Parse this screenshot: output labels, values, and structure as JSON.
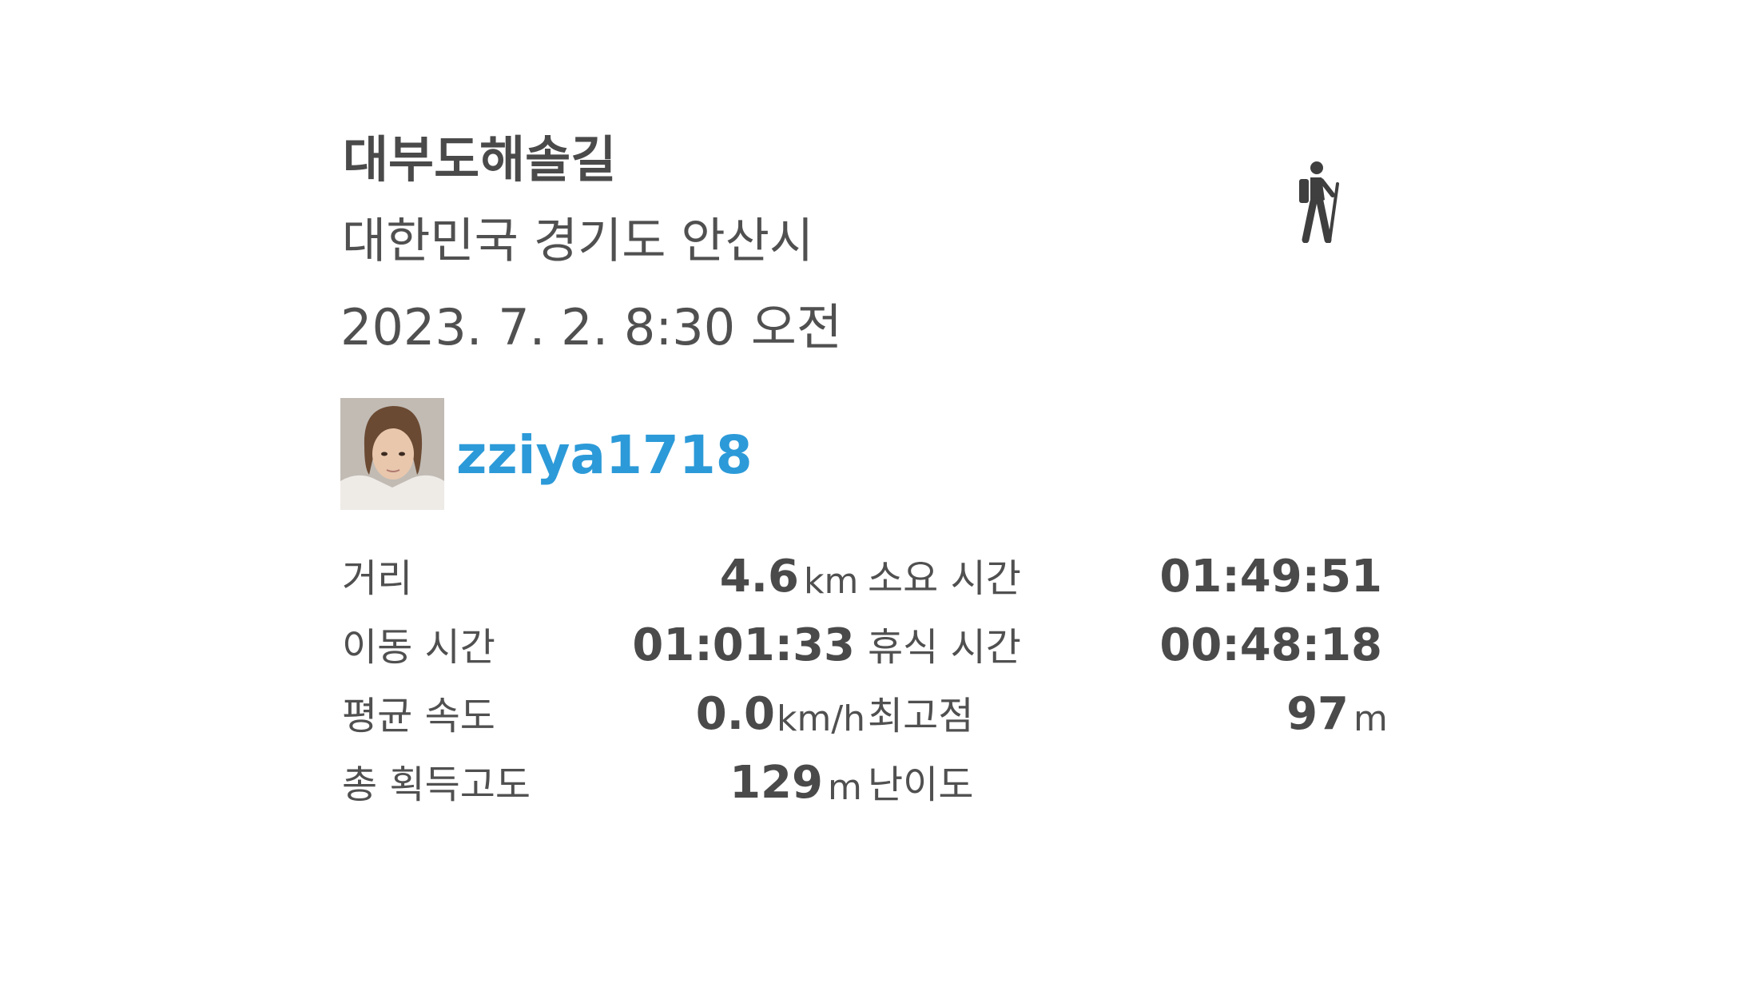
{
  "track": {
    "title": "대부도해솔길",
    "location": "대한민국 경기도 안산시",
    "datetime": "2023. 7. 2. 8:30 오전",
    "activity_icon": "hiking-icon"
  },
  "user": {
    "username": "zziya1718",
    "avatar": "profile-photo"
  },
  "stats": {
    "distance": {
      "label": "거리",
      "value": "4.6",
      "unit": "km"
    },
    "total_time": {
      "label": "소요 시간",
      "value": "01:49:51"
    },
    "moving_time": {
      "label": "이동 시간",
      "value": "01:01:33"
    },
    "rest_time": {
      "label": "휴식 시간",
      "value": "00:48:18"
    },
    "avg_speed": {
      "label": "평균 속도",
      "value": "0.0",
      "unit": "km/h"
    },
    "max_elevation": {
      "label": "최고점",
      "value": "97",
      "unit": "m"
    },
    "total_ascent": {
      "label": "총 획득고도",
      "value": "129",
      "unit": "m"
    },
    "difficulty": {
      "label": "난이도"
    }
  },
  "colors": {
    "username": "#2c9ad8",
    "text": "#505050",
    "icon": "#3f3f3f"
  }
}
